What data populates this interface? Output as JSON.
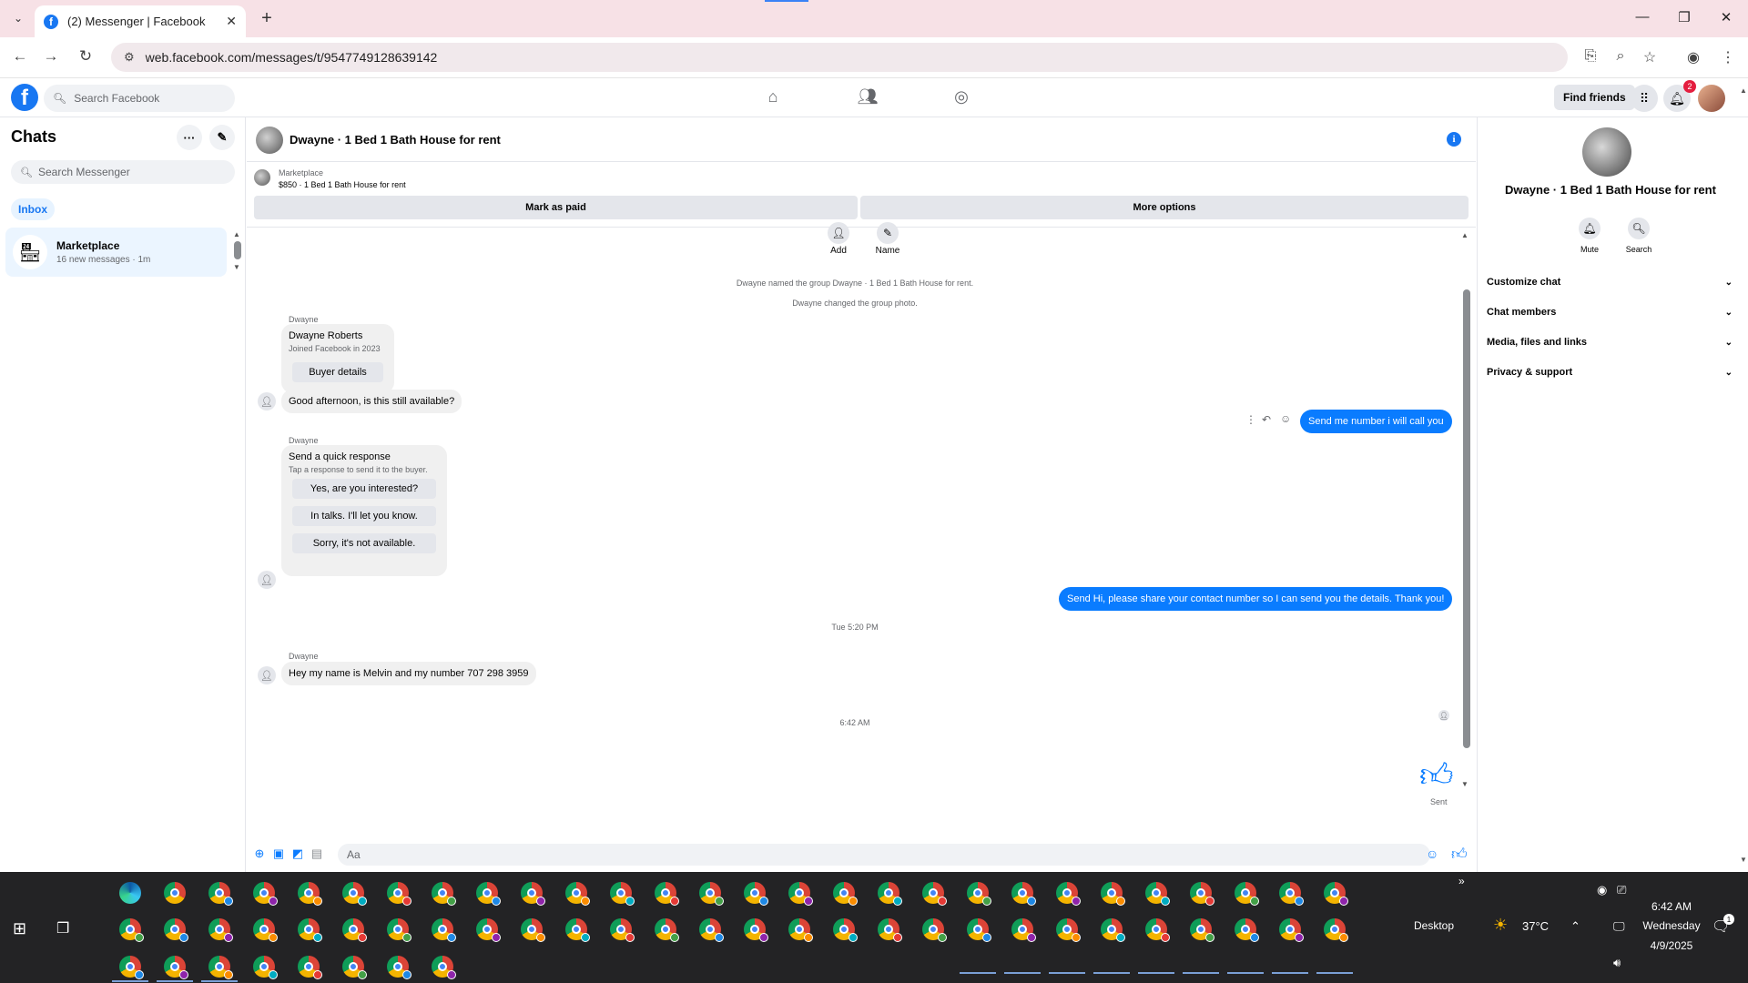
{
  "browser": {
    "tab_title": "(2) Messenger | Facebook",
    "url": "web.facebook.com/messages/t/9547749128639142",
    "icons": [
      "tab-list-icon",
      "facebook-favicon",
      "close-tab-icon",
      "new-tab-icon",
      "minimize-icon",
      "restore-icon",
      "close-window-icon",
      "back-icon",
      "forward-icon",
      "reload-icon",
      "site-info-icon",
      "install-app-icon",
      "zoom-icon",
      "bookmark-star-icon",
      "profile-icon",
      "menu-icon"
    ]
  },
  "fb_header": {
    "search_placeholder": "Search Facebook",
    "find_friends": "Find friends",
    "notif_count": "2"
  },
  "left": {
    "title": "Chats",
    "search_placeholder": "Search Messenger",
    "inbox_label": "Inbox",
    "chats": [
      {
        "name": "Marketplace",
        "sub": "16 new messages · 1m"
      }
    ]
  },
  "conversation": {
    "title": "Dwayne · 1 Bed 1 Bath House for rent",
    "marketplace": {
      "label": "Marketplace",
      "listing": "$850 · 1 Bed 1 Bath House for rent",
      "mark_paid": "Mark as paid",
      "more_options": "More options"
    },
    "actions": {
      "add": "Add",
      "name": "Name"
    },
    "system": [
      "Dwayne named the group Dwayne · 1 Bed 1 Bath House for rent.",
      "Dwayne changed the group photo."
    ],
    "buyer_card": {
      "sender": "Dwayne",
      "name": "Dwayne Roberts",
      "joined": "Joined Facebook in 2023",
      "button": "Buyer details"
    },
    "msg1": "Good afternoon, is this still available?",
    "out1": "Send me number i will call you",
    "quick": {
      "sender": "Dwayne",
      "title": "Send a quick response",
      "sub": "Tap a response to send it to the buyer.",
      "options": [
        "Yes, are you interested?",
        "In talks. I'll let you know.",
        "Sorry, it's not available."
      ]
    },
    "out2": "Send Hi, please share your contact number so I can send you the details. Thank you!",
    "ts1": "Tue 5:20 PM",
    "msg2_sender": "Dwayne",
    "msg2": "Hey my name is Melvin and my number 707 298 3959",
    "ts2": "6:42 AM",
    "sent": "Sent",
    "composer_placeholder": "Aa"
  },
  "right": {
    "title": "Dwayne · 1 Bed 1 Bath House for rent",
    "mute": "Mute",
    "search": "Search",
    "sections": [
      "Customize chat",
      "Chat members",
      "Media, files and links",
      "Privacy & support"
    ]
  },
  "taskbar": {
    "desktop": "Desktop",
    "temp": "37°C",
    "time": "6:42 AM",
    "day": "Wednesday",
    "date": "4/9/2025",
    "notif_count": "1"
  },
  "colors": {
    "accent": "#0a7cff",
    "facebook_blue": "#1877f2",
    "tabstrip": "#f7e1e6",
    "taskbar": "#232325"
  }
}
